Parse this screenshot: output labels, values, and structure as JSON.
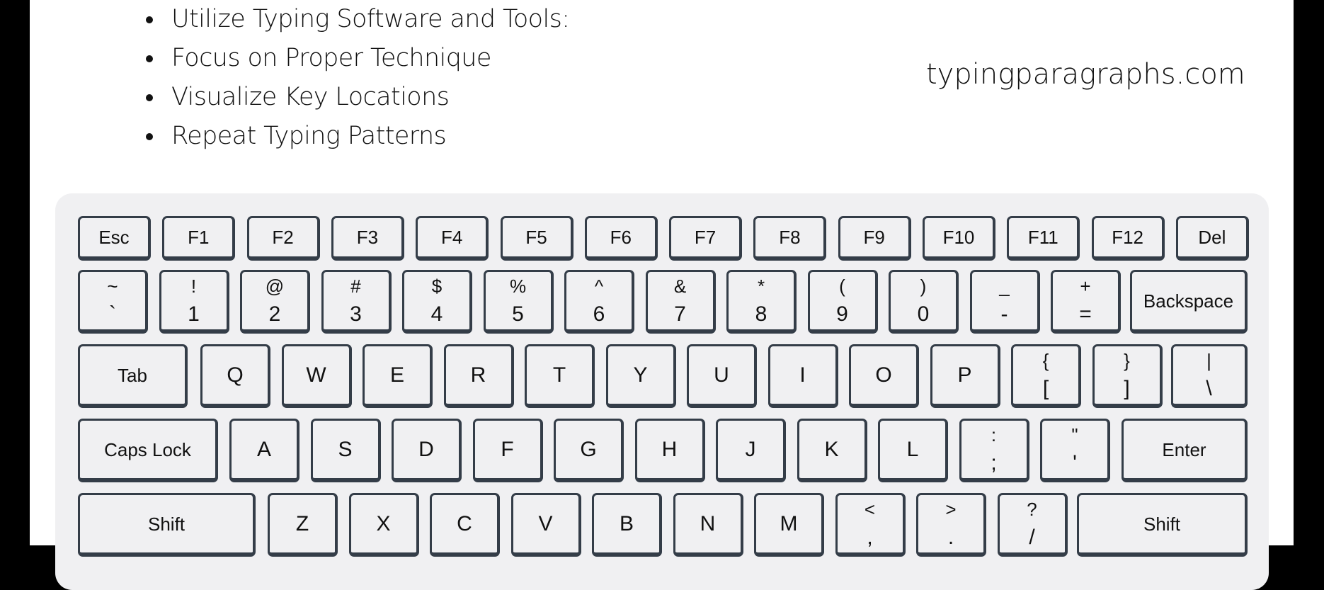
{
  "tips": [
    "Utilize Typing Software and Tools:",
    "Focus on Proper Technique",
    "Visualize Key Locations",
    "Repeat Typing Patterns"
  ],
  "logo": "typingparagraphs.com",
  "colors": {
    "key_border": "#343d48",
    "key_fill": "#f0f0f2",
    "panel": "#f0f0f2",
    "text": "#111111"
  },
  "keyboard": {
    "function_row": [
      "Esc",
      "F1",
      "F2",
      "F3",
      "F4",
      "F5",
      "F6",
      "F7",
      "F8",
      "F9",
      "F10",
      "F11",
      "F12",
      "Del"
    ],
    "number_row": [
      {
        "top": "~",
        "bot": "`"
      },
      {
        "top": "!",
        "bot": "1"
      },
      {
        "top": "@",
        "bot": "2"
      },
      {
        "top": "#",
        "bot": "3"
      },
      {
        "top": "$",
        "bot": "4"
      },
      {
        "top": "%",
        "bot": "5"
      },
      {
        "top": "^",
        "bot": "6"
      },
      {
        "top": "&",
        "bot": "7"
      },
      {
        "top": "*",
        "bot": "8"
      },
      {
        "top": "(",
        "bot": "9"
      },
      {
        "top": ")",
        "bot": "0"
      },
      {
        "top": "_",
        "bot": "-"
      },
      {
        "top": "+",
        "bot": "="
      },
      {
        "label": "Backspace"
      }
    ],
    "tab_row": [
      {
        "label": "Tab"
      },
      {
        "label": "Q"
      },
      {
        "label": "W"
      },
      {
        "label": "E"
      },
      {
        "label": "R"
      },
      {
        "label": "T"
      },
      {
        "label": "Y"
      },
      {
        "label": "U"
      },
      {
        "label": "I"
      },
      {
        "label": "O"
      },
      {
        "label": "P"
      },
      {
        "top": "{",
        "bot": "["
      },
      {
        "top": "}",
        "bot": "]"
      },
      {
        "top": "|",
        "bot": "\\"
      }
    ],
    "caps_row": [
      {
        "label": "Caps Lock"
      },
      {
        "label": "A"
      },
      {
        "label": "S"
      },
      {
        "label": "D"
      },
      {
        "label": "F"
      },
      {
        "label": "G"
      },
      {
        "label": "H"
      },
      {
        "label": "J"
      },
      {
        "label": "K"
      },
      {
        "label": "L"
      },
      {
        "top": ":",
        "bot": ";"
      },
      {
        "top": "\"",
        "bot": "'"
      },
      {
        "label": "Enter"
      }
    ],
    "shift_row": [
      {
        "label": "Shift"
      },
      {
        "label": "Z"
      },
      {
        "label": "X"
      },
      {
        "label": "C"
      },
      {
        "label": "V"
      },
      {
        "label": "B"
      },
      {
        "label": "N"
      },
      {
        "label": "M"
      },
      {
        "top": "<",
        "bot": ","
      },
      {
        "top": ">",
        "bot": "."
      },
      {
        "top": "?",
        "bot": "/"
      },
      {
        "label": "Shift"
      }
    ]
  }
}
